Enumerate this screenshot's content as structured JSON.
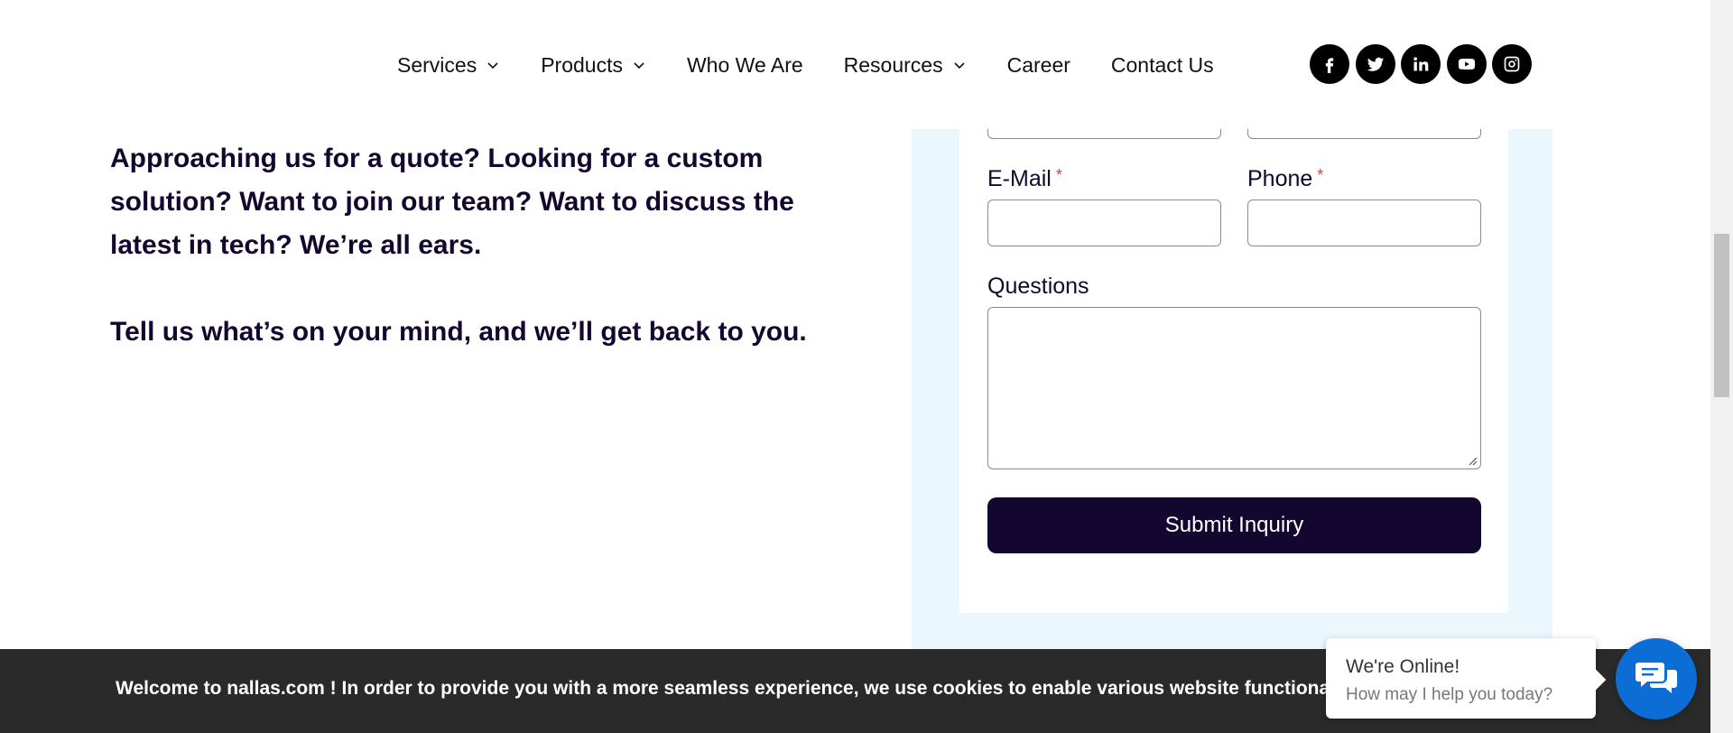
{
  "nav": {
    "items": [
      {
        "label": "Services",
        "has_dropdown": true
      },
      {
        "label": "Products",
        "has_dropdown": true
      },
      {
        "label": "Who We Are",
        "has_dropdown": false
      },
      {
        "label": "Resources",
        "has_dropdown": true
      },
      {
        "label": "Career",
        "has_dropdown": false
      },
      {
        "label": "Contact Us",
        "has_dropdown": false
      }
    ],
    "social": [
      "facebook-icon",
      "twitter-icon",
      "linkedin-icon",
      "youtube-icon",
      "instagram-icon"
    ]
  },
  "intro": {
    "paragraph_1": "Approaching us for a quote? Looking for a custom solution? Want to join our team? Want to discuss the latest in tech? We’re all ears.",
    "paragraph_2": "Tell us what’s on your mind, and we’ll get back to you."
  },
  "form": {
    "email_label": "E-Mail",
    "phone_label": "Phone",
    "required_marker": "*",
    "questions_label": "Questions",
    "email_value": "",
    "phone_value": "",
    "questions_value": "",
    "submit_label": "Submit Inquiry"
  },
  "cookie": {
    "text": "Welcome to nallas.com ! In order to provide you with a more seamless experience, we use cookies to enable various website functionality.",
    "link_text": "s"
  },
  "chat": {
    "title": "We're Online!",
    "subtitle": "How may I help you today?"
  },
  "colors": {
    "brand_dark": "#14072f",
    "form_background": "#eaf7fd",
    "required": "#e53935",
    "chat_blue": "#0c6ed4",
    "cookie_bar": "#2a2a2a"
  }
}
